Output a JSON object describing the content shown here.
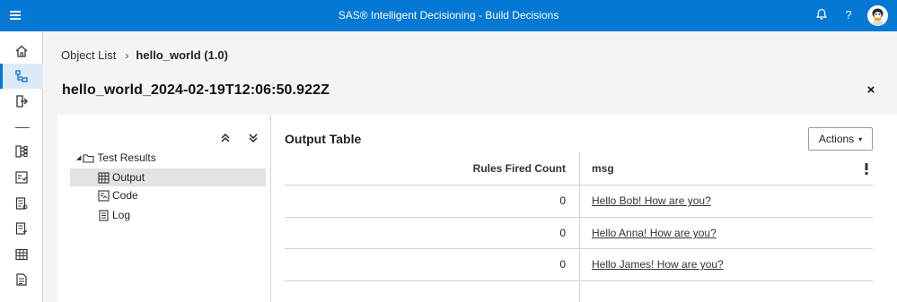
{
  "app": {
    "title": "SAS® Intelligent Decisioning - Build Decisions",
    "menu_icon": "hamburger-icon",
    "notifications_icon": "bell-icon",
    "help_icon": "question-icon",
    "help_glyph": "?",
    "avatar_icon": "user-avatar"
  },
  "rail": {
    "items": [
      {
        "icon": "home-icon",
        "active": false
      },
      {
        "icon": "decisions-icon",
        "active": true
      },
      {
        "icon": "export-icon",
        "active": false
      },
      {
        "icon": "rule-sets-icon",
        "active": false
      },
      {
        "icon": "models-icon",
        "active": false
      },
      {
        "icon": "code-files-icon",
        "active": false
      },
      {
        "icon": "treatments-icon",
        "active": false
      },
      {
        "icon": "lookup-tables-icon",
        "active": false
      },
      {
        "icon": "global-variables-icon",
        "active": false
      }
    ]
  },
  "breadcrumb": {
    "parent": "Object List",
    "separator": "›",
    "current": "hello_world (1.0)"
  },
  "header": {
    "title": "hello_world_2024-02-19T12:06:50.922Z",
    "close_glyph": "×"
  },
  "tree": {
    "expand_all_icon": "expand-all-icon",
    "collapse_all_icon": "collapse-all-icon",
    "root": {
      "label": "Test Results",
      "expanded": true
    },
    "children": [
      {
        "label": "Output",
        "icon": "table-icon",
        "selected": true
      },
      {
        "label": "Code",
        "icon": "code-icon",
        "selected": false
      },
      {
        "label": "Log",
        "icon": "log-icon",
        "selected": false
      }
    ]
  },
  "output": {
    "title": "Output Table",
    "actions_label": "Actions",
    "actions_caret": "▾",
    "columns": [
      "Rules Fired Count",
      "msg"
    ],
    "rows": [
      {
        "rules_fired_count": "0",
        "msg": "Hello Bob! How are you?"
      },
      {
        "rules_fired_count": "0",
        "msg": "Hello Anna! How are you?"
      },
      {
        "rules_fired_count": "0",
        "msg": "Hello James! How are you?"
      }
    ]
  },
  "colors": {
    "topbar": "#0478d4",
    "rail_active": "#dce9f7",
    "selected_row": "#e3e3e3"
  }
}
